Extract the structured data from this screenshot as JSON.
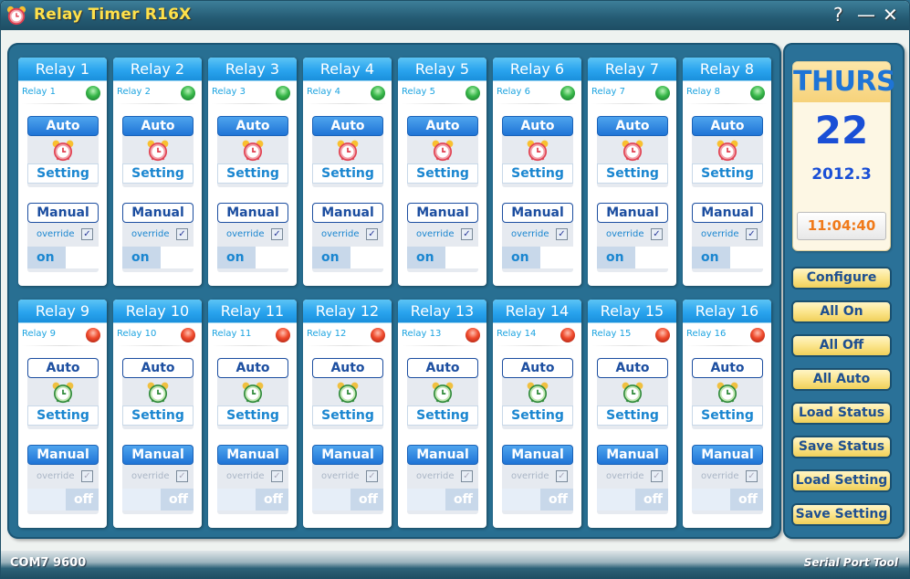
{
  "window": {
    "title": "Relay Timer R16X",
    "help_label": "?",
    "minimize_label": "—",
    "close_label": "✕"
  },
  "relays": [
    {
      "name": "Relay 1",
      "label": "Relay 1",
      "status": "on",
      "mode": "auto",
      "override": true,
      "output": "on"
    },
    {
      "name": "Relay 2",
      "label": "Relay 2",
      "status": "on",
      "mode": "auto",
      "override": true,
      "output": "on"
    },
    {
      "name": "Relay 3",
      "label": "Relay 3",
      "status": "on",
      "mode": "auto",
      "override": true,
      "output": "on"
    },
    {
      "name": "Relay 4",
      "label": "Relay 4",
      "status": "on",
      "mode": "auto",
      "override": true,
      "output": "on"
    },
    {
      "name": "Relay 5",
      "label": "Relay 5",
      "status": "on",
      "mode": "auto",
      "override": true,
      "output": "on"
    },
    {
      "name": "Relay 6",
      "label": "Relay 6",
      "status": "on",
      "mode": "auto",
      "override": true,
      "output": "on"
    },
    {
      "name": "Relay 7",
      "label": "Relay 7",
      "status": "on",
      "mode": "auto",
      "override": true,
      "output": "on"
    },
    {
      "name": "Relay 8",
      "label": "Relay 8",
      "status": "on",
      "mode": "auto",
      "override": true,
      "output": "on"
    },
    {
      "name": "Relay 9",
      "label": "Relay 9",
      "status": "off",
      "mode": "manual",
      "override": true,
      "output": "off"
    },
    {
      "name": "Relay 10",
      "label": "Relay 10",
      "status": "off",
      "mode": "manual",
      "override": true,
      "output": "off"
    },
    {
      "name": "Relay 11",
      "label": "Relay 11",
      "status": "off",
      "mode": "manual",
      "override": true,
      "output": "off"
    },
    {
      "name": "Relay 12",
      "label": "Relay 12",
      "status": "off",
      "mode": "manual",
      "override": true,
      "output": "off"
    },
    {
      "name": "Relay 13",
      "label": "Relay 13",
      "status": "off",
      "mode": "manual",
      "override": true,
      "output": "off"
    },
    {
      "name": "Relay 14",
      "label": "Relay 14",
      "status": "off",
      "mode": "manual",
      "override": true,
      "output": "off"
    },
    {
      "name": "Relay 15",
      "label": "Relay 15",
      "status": "off",
      "mode": "manual",
      "override": true,
      "output": "off"
    },
    {
      "name": "Relay 16",
      "label": "Relay 16",
      "status": "off",
      "mode": "manual",
      "override": true,
      "output": "off"
    }
  ],
  "relay_labels": {
    "auto": "Auto",
    "setting": "Setting",
    "manual": "Manual",
    "override": "override",
    "on": "on",
    "off": "off"
  },
  "calendar": {
    "day": "THURS",
    "date": "22",
    "year_month": "2012.3",
    "time": "11:04:40"
  },
  "side_buttons": [
    "Configure",
    "All On",
    "All Off",
    "All Auto",
    "Load Status",
    "Save Status",
    "Load Setting",
    "Save Setting"
  ],
  "status_bar": {
    "port": "COM7 9600",
    "brand": "Serial Port Tool"
  },
  "colors": {
    "led_on": "#2fae44",
    "led_off": "#e8402a",
    "accent_blue": "#1f74d6",
    "title_yellow": "#ffe14a",
    "time_orange": "#f07a1a"
  }
}
